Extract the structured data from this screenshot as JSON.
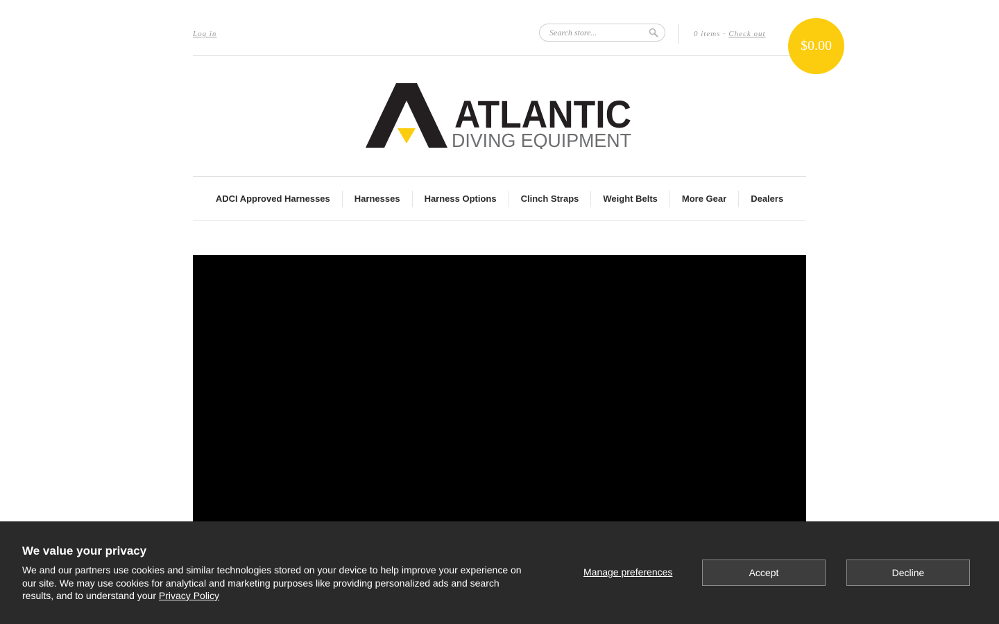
{
  "header": {
    "login_label": "Log in",
    "search": {
      "placeholder": "Search store...",
      "icon": "search-icon"
    },
    "cart": {
      "items_label": "0 items",
      "separator": "·",
      "checkout_label": "Check out",
      "total": "$0.00",
      "accent_color": "#fccc0f"
    }
  },
  "logo": {
    "line1": "ATLANTIC",
    "line2": "DIVING EQUIPMENT",
    "colors": {
      "dark": "#231f20",
      "accent": "#fccc0f",
      "grey": "#6d6e71"
    }
  },
  "nav": {
    "items": [
      {
        "label": "ADCI Approved Harnesses"
      },
      {
        "label": "Harnesses"
      },
      {
        "label": "Harness Options"
      },
      {
        "label": "Clinch Straps"
      },
      {
        "label": "Weight Belts"
      },
      {
        "label": "More Gear"
      },
      {
        "label": "Dealers"
      }
    ]
  },
  "cookie_banner": {
    "title": "We value your privacy",
    "text": "We and our partners use cookies and similar technologies stored on your device to help improve your experience on our site. We may use cookies for analytical and marketing purposes like providing personalized ads and search results, and to understand your",
    "privacy_link": "Privacy Policy",
    "manage_label": "Manage preferences",
    "accept_label": "Accept",
    "decline_label": "Decline",
    "background_color": "#2a2a2a"
  }
}
